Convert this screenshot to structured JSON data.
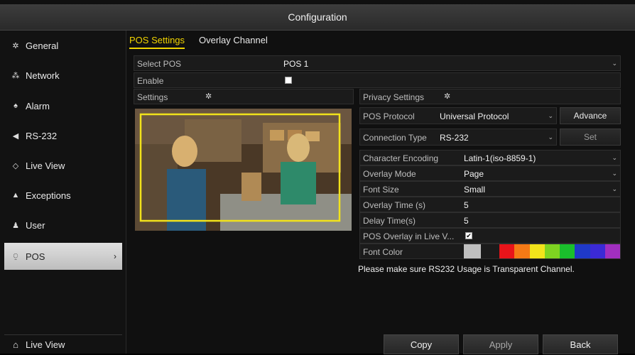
{
  "window": {
    "title": "Configuration"
  },
  "sidebar": {
    "items": [
      {
        "label": "General",
        "icon": "gear-icon",
        "glyph": "✲"
      },
      {
        "label": "Network",
        "icon": "network-icon",
        "glyph": "⁂"
      },
      {
        "label": "Alarm",
        "icon": "alarm-icon",
        "glyph": "♠"
      },
      {
        "label": "RS-232",
        "icon": "serial-port-icon",
        "glyph": "◀"
      },
      {
        "label": "Live View",
        "icon": "live-view-icon",
        "glyph": "◇"
      },
      {
        "label": "Exceptions",
        "icon": "warning-icon",
        "glyph": "▲"
      },
      {
        "label": "User",
        "icon": "user-icon",
        "glyph": "♟"
      },
      {
        "label": "POS",
        "icon": "pos-icon",
        "glyph": "⍜",
        "active": true,
        "chevron": "›"
      }
    ],
    "bottom": {
      "label": "Live View",
      "icon": "home-icon",
      "glyph": "⌂"
    }
  },
  "tabs": [
    {
      "label": "POS Settings",
      "active": true
    },
    {
      "label": "Overlay Channel",
      "active": false
    }
  ],
  "form": {
    "select_pos": {
      "label": "Select POS",
      "value": "POS 1"
    },
    "enable": {
      "label": "Enable",
      "checked": false
    },
    "settings": {
      "label": "Settings",
      "icon": "gear-icon"
    },
    "privacy_settings": {
      "label": "Privacy Settings",
      "icon": "gear-icon"
    },
    "pos_protocol": {
      "label": "POS Protocol",
      "value": "Universal Protocol",
      "button": "Advance"
    },
    "connection_type": {
      "label": "Connection Type",
      "value": "RS-232",
      "button": "Set"
    },
    "character_encoding": {
      "label": "Character Encoding",
      "value": "Latin-1(iso-8859-1)"
    },
    "overlay_mode": {
      "label": "Overlay Mode",
      "value": "Page"
    },
    "font_size": {
      "label": "Font Size",
      "value": "Small"
    },
    "overlay_time": {
      "label": "Overlay Time (s)",
      "value": "5"
    },
    "delay_time": {
      "label": "Delay Time(s)",
      "value": "5"
    },
    "pos_overlay_live": {
      "label": "POS Overlay in Live V...",
      "checked": true
    },
    "font_color": {
      "label": "Font Color",
      "selected": "#c0c0c0",
      "palette": [
        "#e8141a",
        "#f47a16",
        "#f2e31b",
        "#7ed321",
        "#1abf2c",
        "#1f39c8",
        "#3b2ad6",
        "#a12fc0"
      ]
    }
  },
  "note": "Please make sure RS232 Usage is Transparent Channel.",
  "footer": {
    "copy": "Copy",
    "apply": "Apply",
    "back": "Back"
  }
}
